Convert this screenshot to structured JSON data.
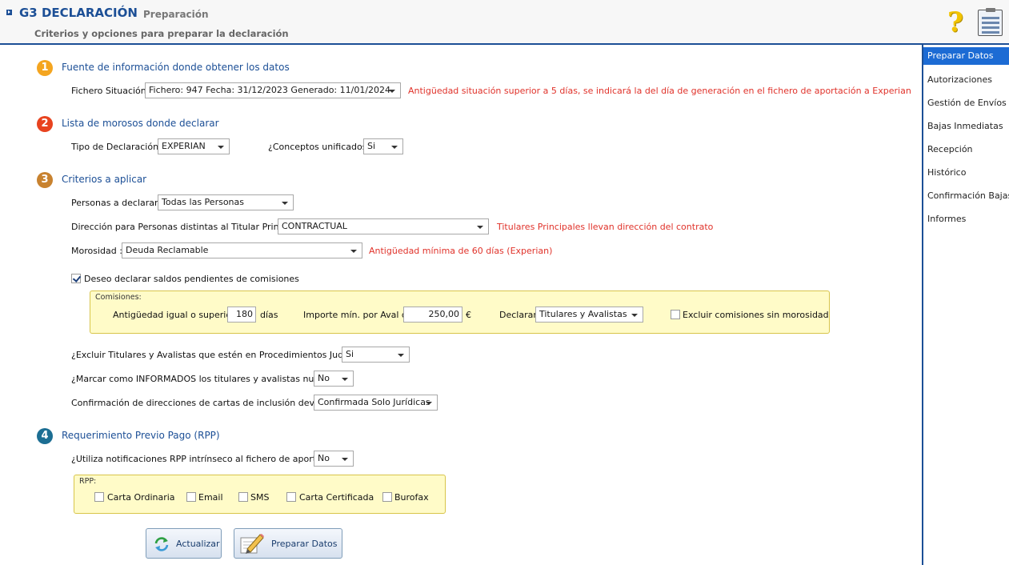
{
  "header": {
    "title": "G3 DECLARACIÓN",
    "section": "Preparación",
    "subtitle": "Criterios y opciones para preparar la declaración"
  },
  "icons": {
    "help": "question-mark-icon",
    "config": "checklist-icon",
    "refresh": "refresh-icon",
    "prepare": "pencil-document-icon"
  },
  "colors": {
    "accent": "#1c4f96",
    "active_nav": "#1c6bd4",
    "warning_text": "#e0322a",
    "panel_bg": "#fffbc8",
    "step1": "#f4a520",
    "step2": "#e8431f",
    "step3": "#c8822f",
    "step4": "#1c6e93"
  },
  "sidebar": {
    "items": [
      {
        "label": "Preparar Datos",
        "active": true
      },
      {
        "label": "Autorizaciones",
        "active": false
      },
      {
        "label": "Gestión de Envíos",
        "active": false
      },
      {
        "label": "Bajas Inmediatas",
        "active": false
      },
      {
        "label": "Recepción",
        "active": false
      },
      {
        "label": "Histórico",
        "active": false
      },
      {
        "label": "Confirmación Bajas",
        "active": false
      },
      {
        "label": "Informes",
        "active": false
      }
    ]
  },
  "sections": {
    "s1": {
      "number": "1",
      "title": "Fuente de información donde obtener los datos",
      "fichero_label": "Fichero Situación :",
      "fichero_value": "Fichero: 947  Fecha: 31/12/2023  Generado: 11/01/2024",
      "fichero_warning": "Antigüedad situación superior a 5 días, se indicará la del día de generación en el fichero de aportación a Experian"
    },
    "s2": {
      "number": "2",
      "title": "Lista de morosos donde declarar",
      "tipo_label": "Tipo de Declaración :",
      "tipo_value": "EXPERIAN",
      "conceptos_label": "¿Conceptos unificados?",
      "conceptos_value": "Si"
    },
    "s3": {
      "number": "3",
      "title": "Criterios a aplicar",
      "personas_label": "Personas a declarar :",
      "personas_value": "Todas las Personas",
      "direccion_label": "Dirección para Personas distintas al Titular Principal :",
      "direccion_value": "CONTRACTUAL",
      "direccion_note": "Titulares Principales llevan dirección del contrato",
      "morosidad_label": "Morosidad :",
      "morosidad_value": "Deuda Reclamable",
      "morosidad_note": "Antigüedad mínima de 60 días (Experian)",
      "comisiones_check_label": "Deseo declarar saldos pendientes de comisiones",
      "comisiones_checked": true,
      "comisiones": {
        "caption": "Comisiones:",
        "antiguedad_label": "Antigüedad igual o superior a",
        "antiguedad_value": "180",
        "antiguedad_unit": "días",
        "importe_label": "Importe mín. por Aval de",
        "importe_value": "250,00",
        "importe_unit": "€",
        "declarar_label": "Declarar",
        "declarar_value": "Titulares y Avalistas",
        "excluir_label": "Excluir comisiones sin morosidad",
        "excluir_checked": false
      },
      "excluir_judicial_label": "¿Excluir Titulares y Avalistas que estén en Procedimientos Judiciales?",
      "excluir_judicial_value": "Si",
      "marcar_label": "¿Marcar como INFORMADOS los titulares y avalistas nuevos?",
      "marcar_value": "No",
      "confirmacion_label": "Confirmación de direcciones de cartas de inclusión devueltas :",
      "confirmacion_value": "Confirmada Solo Jurídicas"
    },
    "s4": {
      "number": "4",
      "title": "Requerimiento Previo Pago (RPP)",
      "rpp_label": "¿Utiliza notificaciones RPP intrínseco al fichero de aportación?",
      "rpp_value": "No",
      "rpp_caption": "RPP:",
      "rpp_options": [
        {
          "label": "Carta Ordinaria",
          "checked": false
        },
        {
          "label": "Email",
          "checked": false
        },
        {
          "label": "SMS",
          "checked": false
        },
        {
          "label": "Carta Certificada",
          "checked": false
        },
        {
          "label": "Burofax",
          "checked": false
        }
      ]
    }
  },
  "buttons": {
    "actualizar": "Actualizar",
    "preparar": "Preparar Datos"
  }
}
